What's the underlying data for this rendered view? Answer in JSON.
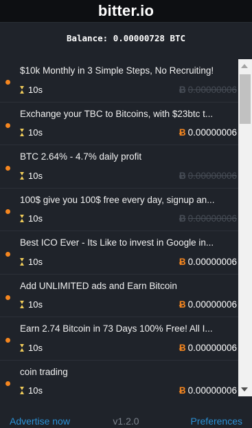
{
  "app": {
    "title": "bitter.io"
  },
  "balance": {
    "label": "Balance:",
    "amount": "0.00000728",
    "unit": "BTC"
  },
  "colors": {
    "accent": "#f5861f",
    "link": "#2b91d6",
    "hourglass": "#f0cc5a",
    "background": "#1f232a"
  },
  "icons": {
    "dot": "status-dot-icon",
    "timer": "hourglass-icon",
    "currency": "bitcoin-icon"
  },
  "items": [
    {
      "title": "$10k Monthly in 3 Simple Steps, No Recruiting!",
      "time": "10s",
      "currency": "Ƀ",
      "amount": "0.00000006",
      "claimed": true
    },
    {
      "title": "Exchange your TBC to Bitcoins, with $23btc t...",
      "time": "10s",
      "currency": "Ƀ",
      "amount": "0.00000006",
      "claimed": false
    },
    {
      "title": "BTC 2.64% - 4.7% daily profit",
      "time": "10s",
      "currency": "Ƀ",
      "amount": "0.00000006",
      "claimed": true
    },
    {
      "title": "100$ give you 100$ free every day, signup an...",
      "time": "10s",
      "currency": "Ƀ",
      "amount": "0.00000006",
      "claimed": true
    },
    {
      "title": "Best ICO Ever - Its Like to invest in Google in...",
      "time": "10s",
      "currency": "Ƀ",
      "amount": "0.00000006",
      "claimed": false
    },
    {
      "title": "Add UNLIMITED ads and Earn Bitcoin",
      "time": "10s",
      "currency": "Ƀ",
      "amount": "0.00000006",
      "claimed": false
    },
    {
      "title": "Earn 2.74 Bitcoin in 73 Days 100% Free! All I...",
      "time": "10s",
      "currency": "Ƀ",
      "amount": "0.00000006",
      "claimed": false
    },
    {
      "title": "coin trading",
      "time": "10s",
      "currency": "Ƀ",
      "amount": "0.00000006",
      "claimed": false
    }
  ],
  "footer": {
    "advertise": "Advertise now",
    "version": "v1.2.0",
    "preferences": "Preferences"
  }
}
